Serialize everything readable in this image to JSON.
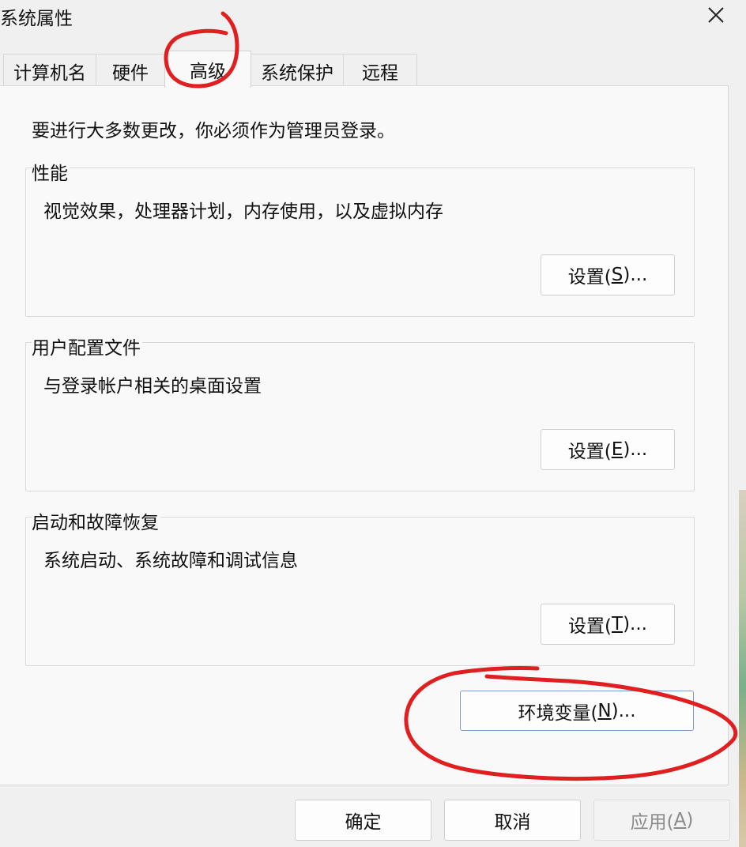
{
  "window": {
    "title": "系统属性",
    "close_icon": "close-icon"
  },
  "tabs": [
    {
      "label": "计算机名",
      "active": false
    },
    {
      "label": "硬件",
      "active": false
    },
    {
      "label": "高级",
      "active": true
    },
    {
      "label": "系统保护",
      "active": false
    },
    {
      "label": "远程",
      "active": false
    }
  ],
  "advanced": {
    "intro": "要进行大多数更改，你必须作为管理员登录。",
    "performance": {
      "title": "性能",
      "description": "视觉效果，处理器计划，内存使用，以及虚拟内存",
      "button": {
        "prefix": "设置(",
        "key": "S",
        "suffix": ")..."
      }
    },
    "user_profiles": {
      "title": "用户配置文件",
      "description": "与登录帐户相关的桌面设置",
      "button": {
        "prefix": "设置(",
        "key": "E",
        "suffix": ")..."
      }
    },
    "startup_recovery": {
      "title": "启动和故障恢复",
      "description": "系统启动、系统故障和调试信息",
      "button": {
        "prefix": "设置(",
        "key": "T",
        "suffix": ")..."
      }
    },
    "env_button": {
      "prefix": "环境变量(",
      "key": "N",
      "suffix": ")..."
    }
  },
  "footer": {
    "ok": "确定",
    "cancel": "取消",
    "apply": {
      "prefix": "应用(",
      "key": "A",
      "suffix": ")",
      "enabled": false
    }
  },
  "annotation_color": "#e02020"
}
